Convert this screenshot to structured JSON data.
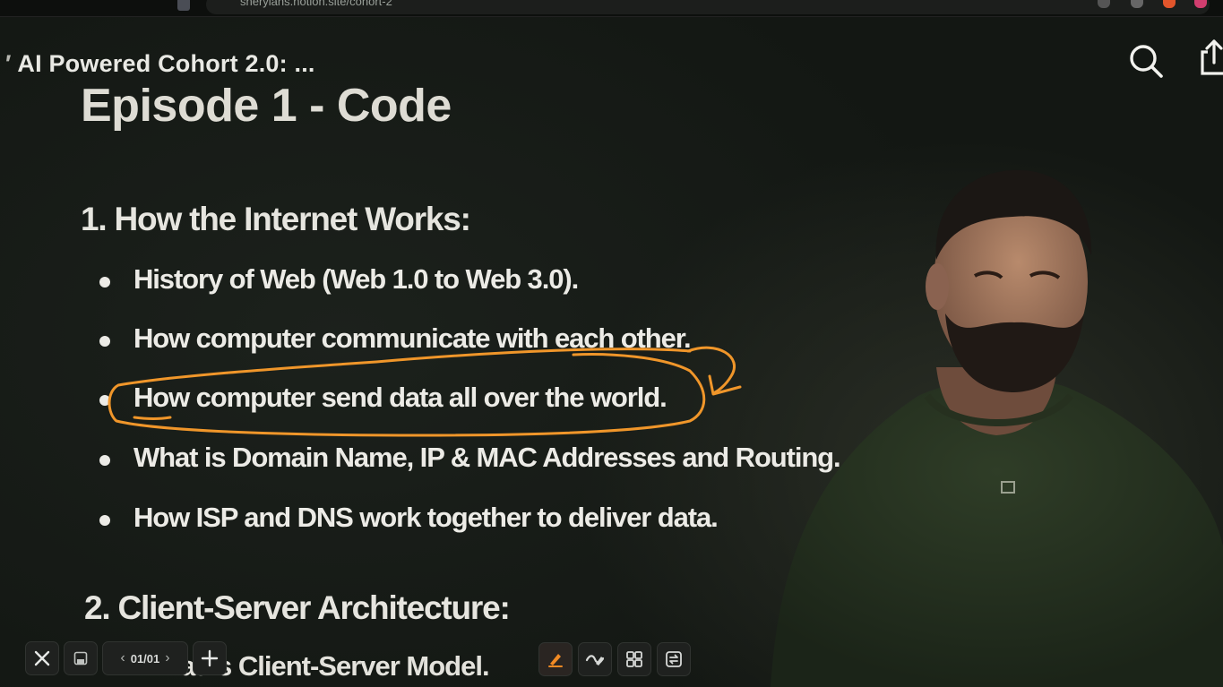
{
  "browser": {
    "url": "sheryians.notion.site/cohort-2"
  },
  "header": {
    "page_title": "AI Powered Cohort 2.0: ...",
    "search_icon": "search-icon",
    "share_icon": "share-icon"
  },
  "document": {
    "heading": "Episode 1 - Code",
    "sections": [
      {
        "title": "1. How the Internet Works:",
        "bullets": [
          "History of Web (Web 1.0 to Web 3.0).",
          "How computer communicate with each other.",
          "How computer send data all over the world.",
          "What is Domain Name, IP & MAC Addresses and Routing.",
          "How ISP and DNS work together to deliver data."
        ]
      },
      {
        "title": "2. Client-Server Architecture:",
        "bullets": [
          "What is Client-Server Model."
        ]
      }
    ]
  },
  "annotation": {
    "color": "#f0962a",
    "highlighted_bullet": "How computer send data all over the world."
  },
  "toolbar": {
    "close_icon": "close-icon",
    "save_icon": "save-icon",
    "page_label": "01/01",
    "add_icon": "plus-icon",
    "tools": [
      "pen-icon",
      "eraser-icon",
      "grid-icon",
      "swap-icon"
    ],
    "accent_color": "#f08a24"
  }
}
